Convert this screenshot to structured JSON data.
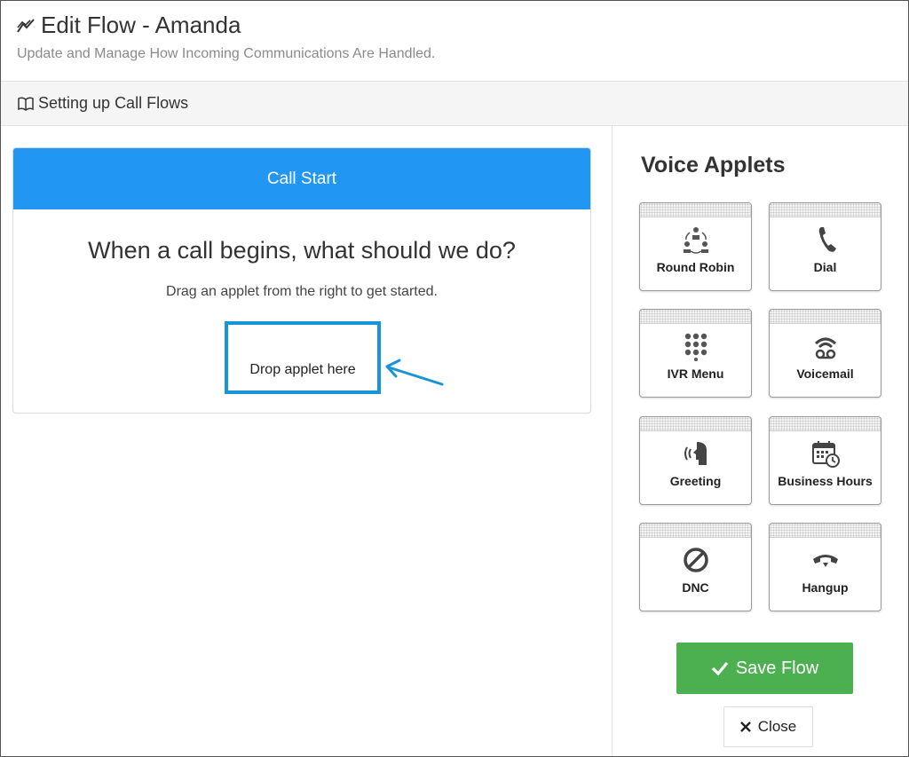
{
  "header": {
    "title": "Edit Flow - Amanda",
    "subtitle": "Update and Manage How Incoming Communications Are Handled.",
    "title_icon": "chart-line-icon"
  },
  "docbar": {
    "link_label": "Setting up Call Flows",
    "link_icon": "book-icon"
  },
  "flow": {
    "start_label": "Call Start",
    "question": "When a call begins, what should we do?",
    "hint": "Drag an applet from the right to get started.",
    "drop_label": "Drop applet here"
  },
  "applets": {
    "title": "Voice Applets",
    "items": [
      {
        "label": "Round Robin",
        "icon": "round-robin-icon"
      },
      {
        "label": "Dial",
        "icon": "phone-icon"
      },
      {
        "label": "IVR Menu",
        "icon": "keypad-icon"
      },
      {
        "label": "Voicemail",
        "icon": "voicemail-icon"
      },
      {
        "label": "Greeting",
        "icon": "greeting-icon"
      },
      {
        "label": "Business Hours",
        "icon": "calendar-clock-icon"
      },
      {
        "label": "DNC",
        "icon": "ban-icon"
      },
      {
        "label": "Hangup",
        "icon": "hangup-icon"
      }
    ]
  },
  "actions": {
    "save_label": "Save Flow",
    "close_label": "Close"
  },
  "colors": {
    "accent": "#2196f3",
    "dropzone": "#1795d6",
    "save": "#4caf50"
  }
}
